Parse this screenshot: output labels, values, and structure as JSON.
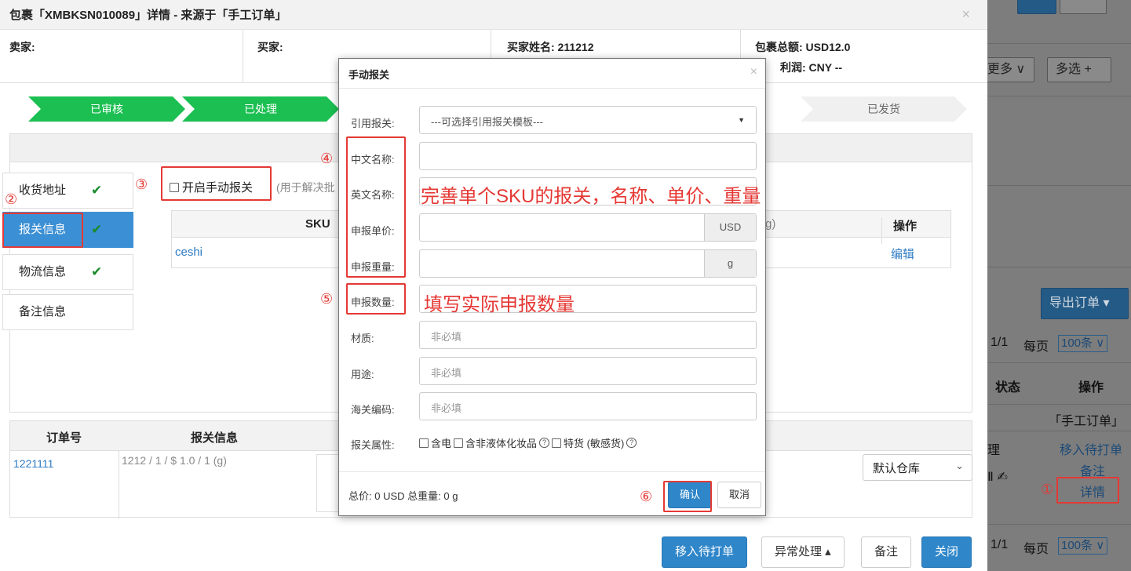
{
  "modal": {
    "title": "包裹「XMBKSN010089」详情 - 来源于「手工订单」",
    "close": "×"
  },
  "info": {
    "seller_label": "卖家:",
    "buyer_label": "买家:",
    "buyer_name_label": "买家姓名: 211212",
    "total_label": "包裹总额: USD12.0",
    "profit_label": "利润: CNY --"
  },
  "steps": [
    "已审核",
    "已处理",
    "已发货"
  ],
  "side_tabs": [
    {
      "label": "收货地址",
      "check": "✔"
    },
    {
      "label": "报关信息",
      "check": "✔"
    },
    {
      "label": "物流信息",
      "check": "✔"
    },
    {
      "label": "备注信息",
      "check": ""
    }
  ],
  "manual": {
    "label": "开启手动报关",
    "hint": "(用于解决批"
  },
  "sku_table": {
    "col_sku": "SKU",
    "col_partial": "g)",
    "col_op": "操作",
    "row_sku": "ceshi",
    "row_op": "编辑"
  },
  "order_table": {
    "col_no": "订单号",
    "col_info": "报关信息",
    "row_no": "1221111",
    "row_info": "1212 / 1 / $ 1.0 / 1  (g)",
    "warehouse": "默认仓库"
  },
  "footer": {
    "move": "移入待打单",
    "exception": "异常处理 ▴",
    "remark": "备注",
    "close": "关闭"
  },
  "dialog": {
    "title": "手动报关",
    "close": "×",
    "template_label": "引用报关:",
    "template_value": "---可选择引用报关模板---",
    "cn_name_label": "中文名称:",
    "en_name_label": "英文名称:",
    "price_label": "申报单价:",
    "price_unit": "USD",
    "weight_label": "申报重量:",
    "weight_unit": "g",
    "qty_label": "申报数量:",
    "material_label": "材质:",
    "material_ph": "非必填",
    "usage_label": "用途:",
    "usage_ph": "非必填",
    "hs_label": "海关编码:",
    "hs_ph": "非必填",
    "attr_label": "报关属性:",
    "attr_battery": "含电",
    "attr_liquid": "含非液体化妆品",
    "attr_special": "特货 (敏感货)",
    "total": "总价: 0 USD   总重量: 0 g",
    "confirm": "确认",
    "cancel": "取消"
  },
  "annotations": {
    "n1": "①",
    "n2": "②",
    "n3": "③",
    "n4": "④",
    "n5": "⑤",
    "n6": "⑥",
    "note_sku": "完善单个SKU的报关，名称、单价、重量",
    "note_qty": "填写实际申报数量"
  },
  "background": {
    "more": "更多 ∨",
    "multi": "多选 +",
    "export": "导出订单 ▾",
    "pagination": "1/1",
    "per_page": "每页",
    "page_size": "100条 ∨",
    "col_status": "状态",
    "col_op": "操作",
    "source": "「手工订单」",
    "move_link": "移入待打单",
    "remark_link": "备注",
    "detail_link": "详情",
    "status_frag": "理",
    "pagination2": "1/1",
    "per_page2": "每页",
    "page_size2": "100条 ∨"
  },
  "colors": {
    "step_done": "#1bbf52",
    "primary": "#2f86c9",
    "annotation": "#e53935"
  }
}
